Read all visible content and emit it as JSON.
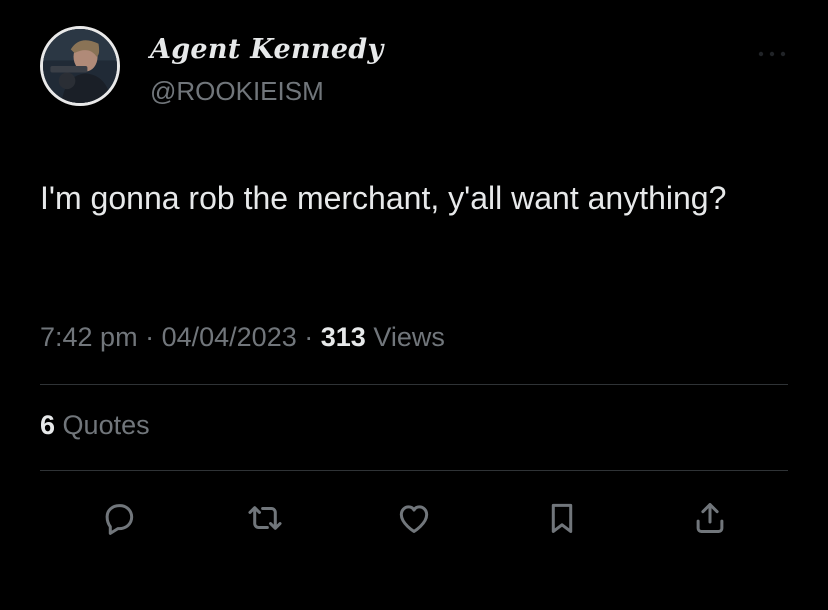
{
  "author": {
    "display_name": "Agent Kennedy",
    "handle": "@ROOKIEISM",
    "avatar_icon": "profile-photo-avatar"
  },
  "tweet": {
    "text": "I'm gonna rob the merchant, y'all want anything?"
  },
  "meta": {
    "time": "7:42 pm",
    "separator": "·",
    "date": "04/04/2023",
    "views_count": "313",
    "views_label": "Views"
  },
  "stats": {
    "quotes_count": "6",
    "quotes_label": "Quotes"
  },
  "actions": [
    {
      "name": "reply",
      "icon": "speech-bubble-icon"
    },
    {
      "name": "retweet",
      "icon": "retweet-icon"
    },
    {
      "name": "like",
      "icon": "heart-icon"
    },
    {
      "name": "bookmark",
      "icon": "bookmark-icon"
    },
    {
      "name": "share",
      "icon": "share-icon"
    }
  ],
  "colors": {
    "background": "#000000",
    "primary_text": "#e7e9ea",
    "secondary_text": "#71767b",
    "divider": "#2f3336"
  }
}
